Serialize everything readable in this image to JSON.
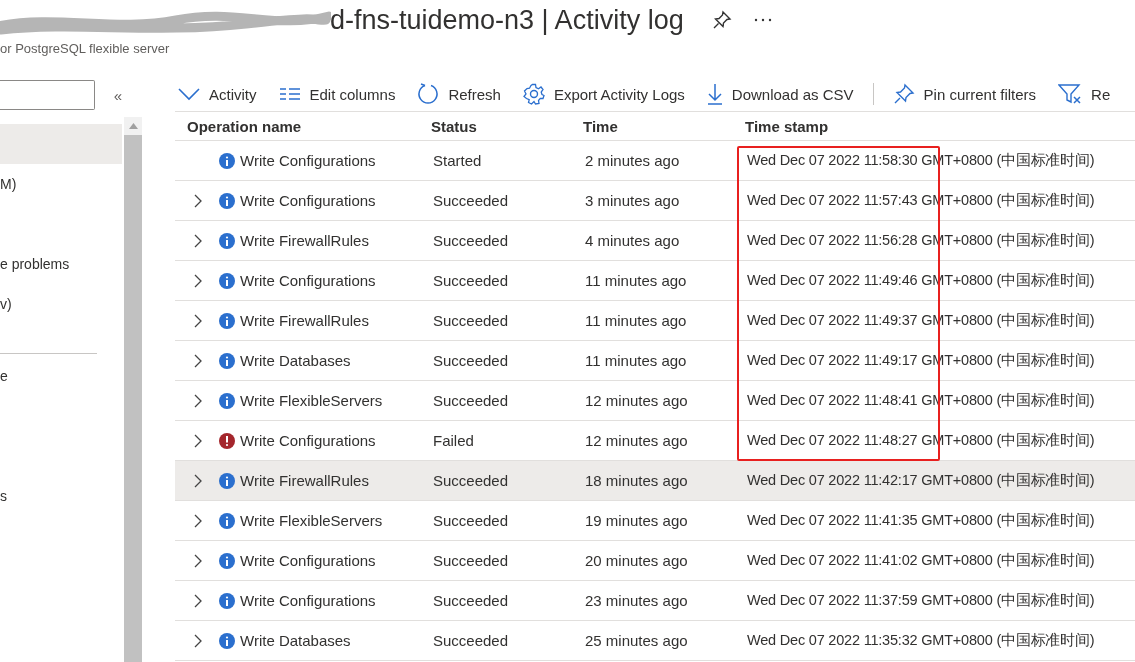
{
  "header": {
    "title": "d-fns-tuidemo-n3 | Activity log",
    "subtitle": "or PostgreSQL flexible server"
  },
  "sidebar": {
    "items": [
      {
        "selected": true
      },
      {
        "label": "M)",
        "selected": false
      },
      {
        "label": "e problems",
        "selected": false
      },
      {
        "label": "v)",
        "selected": false
      },
      {
        "kind": "divider"
      },
      {
        "label": "e",
        "selected": false
      },
      {
        "label": "s",
        "selected": false
      }
    ]
  },
  "collapse": "«",
  "toolbar": [
    {
      "kind": "chevron",
      "label": "Activity"
    },
    {
      "kind": "columns",
      "label": "Edit columns"
    },
    {
      "kind": "refresh",
      "label": "Refresh"
    },
    {
      "kind": "gear",
      "label": "Export Activity Logs"
    },
    {
      "kind": "download",
      "label": "Download as CSV"
    },
    {
      "kind": "separator"
    },
    {
      "kind": "pin",
      "label": "Pin current filters"
    },
    {
      "kind": "filter",
      "label": "Re"
    }
  ],
  "table": {
    "columns": [
      "Operation name",
      "Status",
      "Time",
      "Time stamp"
    ],
    "rows": [
      {
        "expandable": false,
        "kind": "info",
        "operation": "Write Configurations",
        "status": "Started",
        "time": "2 minutes ago",
        "timestamp": "Wed Dec 07 2022 11:58:30 GMT+0800 (中国标准时间)",
        "selected": false,
        "boxed": true
      },
      {
        "expandable": true,
        "kind": "info",
        "operation": "Write Configurations",
        "status": "Succeeded",
        "time": "3 minutes ago",
        "timestamp": "Wed Dec 07 2022 11:57:43 GMT+0800 (中国标准时间)",
        "selected": false,
        "boxed": true
      },
      {
        "expandable": true,
        "kind": "info",
        "operation": "Write FirewallRules",
        "status": "Succeeded",
        "time": "4 minutes ago",
        "timestamp": "Wed Dec 07 2022 11:56:28 GMT+0800 (中国标准时间)",
        "selected": false,
        "boxed": true
      },
      {
        "expandable": true,
        "kind": "info",
        "operation": "Write Configurations",
        "status": "Succeeded",
        "time": "11 minutes ago",
        "timestamp": "Wed Dec 07 2022 11:49:46 GMT+0800 (中国标准时间)",
        "selected": false,
        "boxed": true
      },
      {
        "expandable": true,
        "kind": "info",
        "operation": "Write FirewallRules",
        "status": "Succeeded",
        "time": "11 minutes ago",
        "timestamp": "Wed Dec 07 2022 11:49:37 GMT+0800 (中国标准时间)",
        "selected": false,
        "boxed": true
      },
      {
        "expandable": true,
        "kind": "info",
        "operation": "Write Databases",
        "status": "Succeeded",
        "time": "11 minutes ago",
        "timestamp": "Wed Dec 07 2022 11:49:17 GMT+0800 (中国标准时间)",
        "selected": false,
        "boxed": true
      },
      {
        "expandable": true,
        "kind": "info",
        "operation": "Write FlexibleServers",
        "status": "Succeeded",
        "time": "12 minutes ago",
        "timestamp": "Wed Dec 07 2022 11:48:41 GMT+0800 (中国标准时间)",
        "selected": false,
        "boxed": true
      },
      {
        "expandable": true,
        "kind": "error",
        "operation": "Write Configurations",
        "status": "Failed",
        "time": "12 minutes ago",
        "timestamp": "Wed Dec 07 2022 11:48:27 GMT+0800 (中国标准时间)",
        "selected": false,
        "boxed": true
      },
      {
        "expandable": true,
        "kind": "info",
        "operation": "Write FirewallRules",
        "status": "Succeeded",
        "time": "18 minutes ago",
        "timestamp": "Wed Dec 07 2022 11:42:17 GMT+0800 (中国标准时间)",
        "selected": true,
        "boxed": false
      },
      {
        "expandable": true,
        "kind": "info",
        "operation": "Write FlexibleServers",
        "status": "Succeeded",
        "time": "19 minutes ago",
        "timestamp": "Wed Dec 07 2022 11:41:35 GMT+0800 (中国标准时间)",
        "selected": false,
        "boxed": false
      },
      {
        "expandable": true,
        "kind": "info",
        "operation": "Write Configurations",
        "status": "Succeeded",
        "time": "20 minutes ago",
        "timestamp": "Wed Dec 07 2022 11:41:02 GMT+0800 (中国标准时间)",
        "selected": false,
        "boxed": false
      },
      {
        "expandable": true,
        "kind": "info",
        "operation": "Write Configurations",
        "status": "Succeeded",
        "time": "23 minutes ago",
        "timestamp": "Wed Dec 07 2022 11:37:59 GMT+0800 (中国标准时间)",
        "selected": false,
        "boxed": false
      },
      {
        "expandable": true,
        "kind": "info",
        "operation": "Write Databases",
        "status": "Succeeded",
        "time": "25 minutes ago",
        "timestamp": "Wed Dec 07 2022 11:35:32 GMT+0800 (中国标准时间)",
        "selected": false,
        "boxed": false
      }
    ]
  }
}
